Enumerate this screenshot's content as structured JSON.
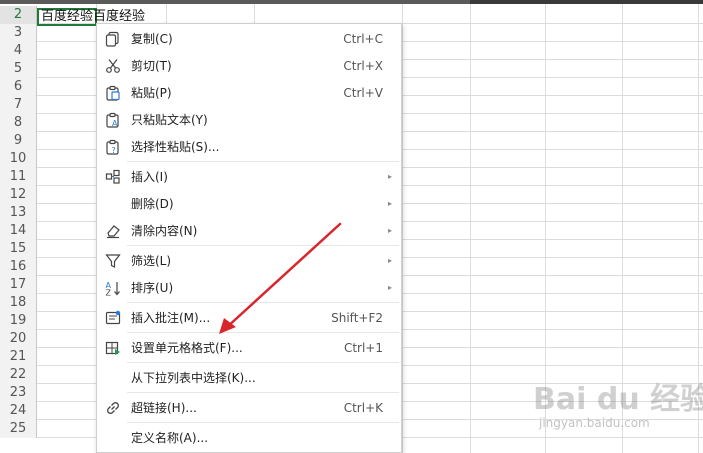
{
  "sheet": {
    "rows": [
      "2",
      "3",
      "4",
      "5",
      "6",
      "7",
      "8",
      "9",
      "10",
      "11",
      "12",
      "13",
      "14",
      "15",
      "16",
      "17",
      "18",
      "19",
      "20",
      "21",
      "22",
      "23",
      "24",
      "25"
    ],
    "active_row": "2",
    "cell_text": "百度经验百度经验"
  },
  "menu": {
    "items": [
      {
        "label": "复制(C)",
        "shortcut": "Ctrl+C",
        "icon": "copy-icon"
      },
      {
        "label": "剪切(T)",
        "shortcut": "Ctrl+X",
        "icon": "scissors-icon"
      },
      {
        "label": "粘贴(P)",
        "shortcut": "Ctrl+V",
        "icon": "paste-icon"
      },
      {
        "label": "只粘贴文本(Y)",
        "shortcut": "",
        "icon": "paste-text-icon"
      },
      {
        "label": "选择性粘贴(S)...",
        "shortcut": "",
        "icon": "paste-special-icon"
      },
      {
        "label": "插入(I)",
        "shortcut": "",
        "icon": "insert-icon",
        "submenu": true
      },
      {
        "label": "删除(D)",
        "shortcut": "",
        "icon": "",
        "submenu": true
      },
      {
        "label": "清除内容(N)",
        "shortcut": "",
        "icon": "eraser-icon",
        "submenu": true
      },
      {
        "label": "筛选(L)",
        "shortcut": "",
        "icon": "filter-icon",
        "submenu": true
      },
      {
        "label": "排序(U)",
        "shortcut": "",
        "icon": "sort-az-icon",
        "submenu": true
      },
      {
        "label": "插入批注(M)...",
        "shortcut": "Shift+F2",
        "icon": "comment-icon"
      },
      {
        "label": "设置单元格格式(F)...",
        "shortcut": "Ctrl+1",
        "icon": "format-cells-icon"
      },
      {
        "label": "从下拉列表中选择(K)...",
        "shortcut": "",
        "icon": ""
      },
      {
        "label": "超链接(H)...",
        "shortcut": "Ctrl+K",
        "icon": "link-icon"
      },
      {
        "label": "定义名称(A)...",
        "shortcut": "",
        "icon": ""
      }
    ],
    "submenu_arrow": "▸"
  },
  "annotation": {
    "color": "#d9262c"
  },
  "watermark": {
    "brand": "Bai du 经验",
    "url": "jingyan.baidu.com"
  }
}
